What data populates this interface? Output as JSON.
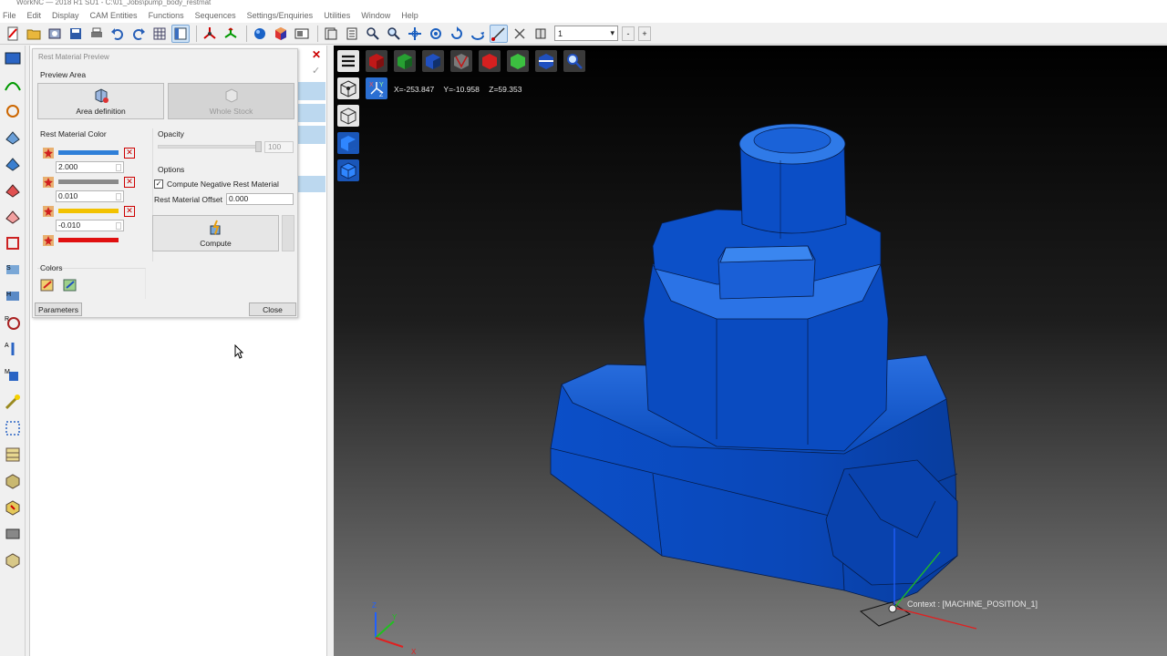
{
  "window": {
    "title": "WorkNC — 2018 R1 SU1 - C:\\01_Jobs\\pump_body_restmat"
  },
  "menu": [
    "File",
    "Edit",
    "Display",
    "CAM Entities",
    "Functions",
    "Sequences",
    "Settings/Enquiries",
    "Utilities",
    "Window",
    "Help"
  ],
  "toolbar": {
    "view_select_value": "1",
    "minus_label": "-",
    "plus_label": "+"
  },
  "dialog": {
    "title": "Rest Material Preview",
    "preview_area_label": "Preview Area",
    "area_definition_label": "Area definition",
    "whole_stock_label": "Whole Stock",
    "rest_material_color_label": "Rest Material Color",
    "thresholds": [
      "2.000",
      "0.010",
      "-0.010"
    ],
    "colors": [
      "#2f7fd8",
      "#8a8a8a",
      "#f2c200",
      "#e01010"
    ],
    "opacity_label": "Opacity",
    "opacity_value": "100",
    "options_label": "Options",
    "compute_negative_label": "Compute Negative Rest Material",
    "compute_negative_checked": "✓",
    "offset_label": "Rest Material Offset",
    "offset_value": "0.000",
    "compute_label": "Compute",
    "colors_label": "Colors",
    "parameters_label": "Parameters",
    "close_label": "Close"
  },
  "viewport": {
    "coord_x": "X=-253.847",
    "coord_y": "Y=-10.958",
    "coord_z": "Z=59.353",
    "context_label": "Context : [MACHINE_POSITION_1]",
    "model_color": "#0a4fc4",
    "axis_labels": {
      "x": "X",
      "y": "Y",
      "z": "Z"
    }
  }
}
